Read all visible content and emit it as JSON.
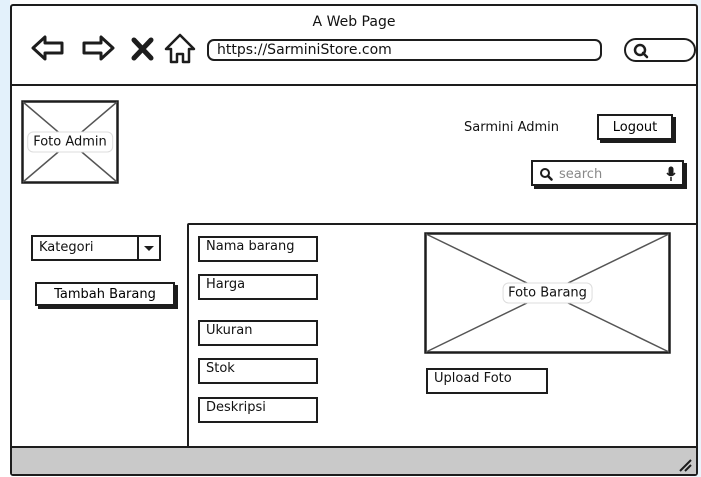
{
  "browser": {
    "title": "A Web Page",
    "url": "https://SarminiStore.com",
    "icons": [
      "back-arrow-icon",
      "forward-arrow-icon",
      "close-icon",
      "home-icon",
      "search-icon"
    ]
  },
  "header": {
    "admin_photo_label": "Foto Admin",
    "user_name": "Sarmini Admin",
    "logout_label": "Logout",
    "search_placeholder": "search"
  },
  "sidebar": {
    "category_label": "Kategori",
    "add_item_label": "Tambah Barang"
  },
  "form": {
    "fields": [
      "Nama barang",
      "Harga",
      "Ukuran",
      "Stok",
      "Deskripsi"
    ],
    "photo_label": "Foto Barang",
    "upload_label": "Upload Foto"
  }
}
